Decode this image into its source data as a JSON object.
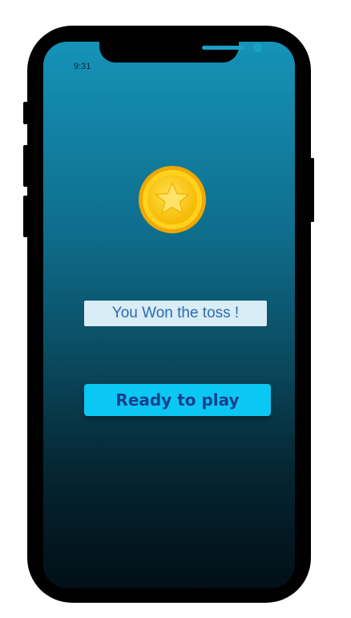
{
  "status_bar": {
    "time": "9:31"
  },
  "coin": {
    "icon": "star-coin-icon",
    "colors": {
      "rim": "#f2b705",
      "face": "#ffd21f",
      "star": "#ffe36b"
    }
  },
  "result": {
    "text": "You Won the toss !"
  },
  "actions": {
    "ready_label": "Ready to play"
  },
  "colors": {
    "screen_top": "#1593b8",
    "screen_bottom": "#020f16",
    "result_bg": "#d9edf6",
    "result_text": "#2a6cb0",
    "button_bg": "#0ac7f4",
    "button_text": "#1a3f8c"
  }
}
